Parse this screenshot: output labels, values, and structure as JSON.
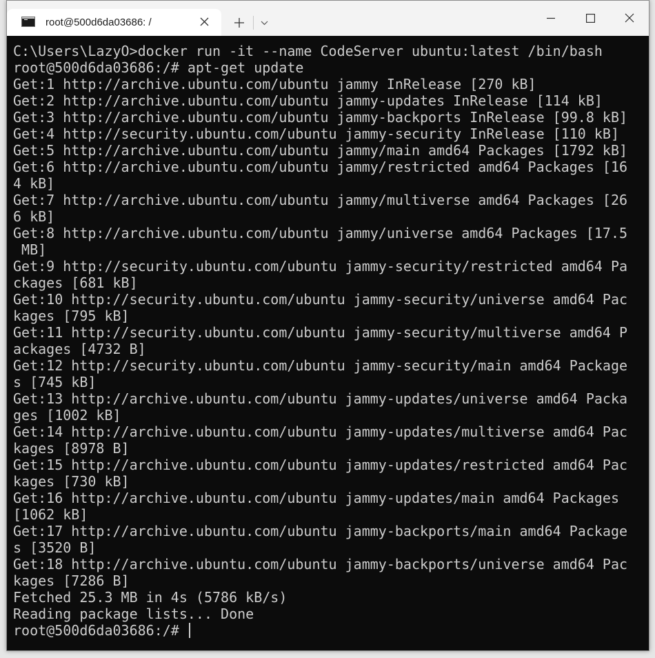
{
  "window": {
    "tab_title": "root@500d6da03686: /"
  },
  "icons": {
    "tab": "terminal-icon",
    "close_tab": "close-icon",
    "new_tab": "plus-icon",
    "dropdown": "chevron-down-icon",
    "minimize": "minimize-icon",
    "maximize": "maximize-icon",
    "close_window": "close-icon"
  },
  "colors": {
    "terminal_bg": "#0c0c0c",
    "terminal_fg": "#cccccc",
    "titlebar_bg": "#f3f3f3",
    "tab_bg": "#ffffff"
  },
  "terminal": {
    "lines": [
      "C:\\Users\\LazyO>docker run -it --name CodeServer ubuntu:latest /bin/bash",
      "root@500d6da03686:/# apt-get update",
      "Get:1 http://archive.ubuntu.com/ubuntu jammy InRelease [270 kB]",
      "Get:2 http://archive.ubuntu.com/ubuntu jammy-updates InRelease [114 kB]",
      "Get:3 http://archive.ubuntu.com/ubuntu jammy-backports InRelease [99.8 kB]",
      "Get:4 http://security.ubuntu.com/ubuntu jammy-security InRelease [110 kB]",
      "Get:5 http://archive.ubuntu.com/ubuntu jammy/main amd64 Packages [1792 kB]",
      "Get:6 http://archive.ubuntu.com/ubuntu jammy/restricted amd64 Packages [16",
      "4 kB]",
      "Get:7 http://archive.ubuntu.com/ubuntu jammy/multiverse amd64 Packages [26",
      "6 kB]",
      "Get:8 http://archive.ubuntu.com/ubuntu jammy/universe amd64 Packages [17.5",
      " MB]",
      "Get:9 http://security.ubuntu.com/ubuntu jammy-security/restricted amd64 Pa",
      "ckages [681 kB]",
      "Get:10 http://security.ubuntu.com/ubuntu jammy-security/universe amd64 Pac",
      "kages [795 kB]",
      "Get:11 http://security.ubuntu.com/ubuntu jammy-security/multiverse amd64 P",
      "ackages [4732 B]",
      "Get:12 http://security.ubuntu.com/ubuntu jammy-security/main amd64 Package",
      "s [745 kB]",
      "Get:13 http://archive.ubuntu.com/ubuntu jammy-updates/universe amd64 Packa",
      "ges [1002 kB]",
      "Get:14 http://archive.ubuntu.com/ubuntu jammy-updates/multiverse amd64 Pac",
      "kages [8978 B]",
      "Get:15 http://archive.ubuntu.com/ubuntu jammy-updates/restricted amd64 Pac",
      "kages [730 kB]",
      "Get:16 http://archive.ubuntu.com/ubuntu jammy-updates/main amd64 Packages",
      "[1062 kB]",
      "Get:17 http://archive.ubuntu.com/ubuntu jammy-backports/main amd64 Package",
      "s [3520 B]",
      "Get:18 http://archive.ubuntu.com/ubuntu jammy-backports/universe amd64 Pac",
      "kages [7286 B]",
      "Fetched 25.3 MB in 4s (5786 kB/s)",
      "Reading package lists... Done"
    ],
    "prompt": "root@500d6da03686:/# "
  }
}
